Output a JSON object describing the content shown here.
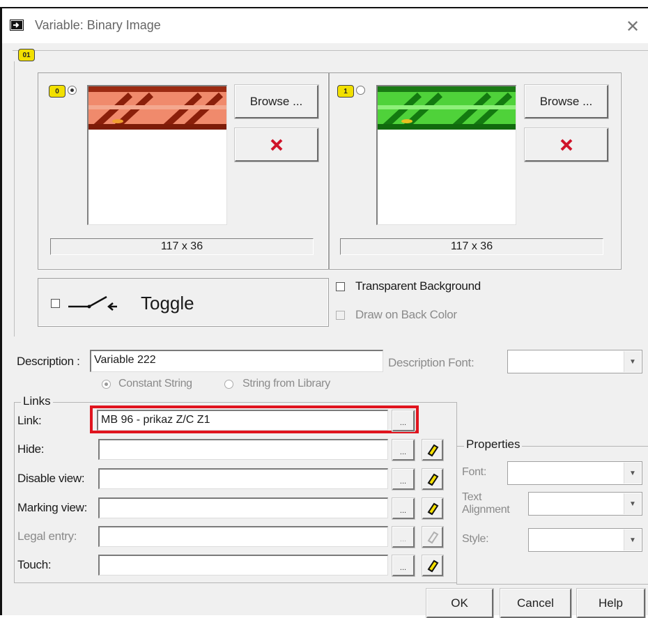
{
  "window": {
    "title": "Variable: Binary Image",
    "close_glyph": "✕"
  },
  "states": [
    {
      "badge": "0",
      "browse_label": "Browse ...",
      "size": "117 x 36",
      "selected": true,
      "accent": "#c0392b"
    },
    {
      "badge": "1",
      "browse_label": "Browse ...",
      "size": "117 x 36",
      "selected": false,
      "accent": "#1e9e1e"
    }
  ],
  "group_badge": "01",
  "toggle": {
    "label": "Toggle",
    "checked": false
  },
  "options": {
    "transparent_background": "Transparent Background",
    "draw_on_back_color": "Draw on Back Color"
  },
  "description": {
    "label": "Description :",
    "value": "Variable 222",
    "font_label": "Description Font:",
    "constant_string": "Constant String",
    "string_from_library": "String from Library"
  },
  "links": {
    "title": "Links",
    "rows": [
      {
        "label": "Link:",
        "value": "MB 96  - prikaz Z/C Z1"
      },
      {
        "label": "Hide:",
        "value": ""
      },
      {
        "label": "Disable view:",
        "value": ""
      },
      {
        "label": "Marking view:",
        "value": ""
      },
      {
        "label": "Legal entry:",
        "value": ""
      },
      {
        "label": "Touch:",
        "value": ""
      }
    ],
    "dots": "..."
  },
  "properties": {
    "title": "Properties",
    "font_label": "Font:",
    "text_alignment_label_1": "Text",
    "text_alignment_label_2": "Alignment",
    "style_label": "Style:"
  },
  "buttons": {
    "ok": "OK",
    "cancel": "Cancel",
    "help": "Help"
  },
  "highlight_color": "#e0141e"
}
